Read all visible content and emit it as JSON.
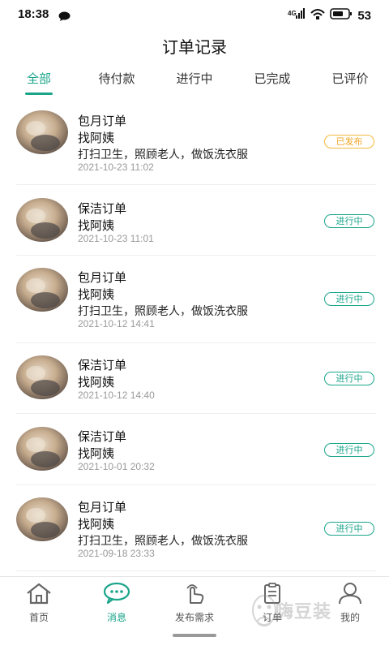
{
  "status_bar": {
    "time": "18:38",
    "battery": "53"
  },
  "page_title": "订单记录",
  "tabs": [
    {
      "label": "全部",
      "active": true
    },
    {
      "label": "待付款",
      "active": false
    },
    {
      "label": "进行中",
      "active": false
    },
    {
      "label": "已完成",
      "active": false
    },
    {
      "label": "已评价",
      "active": false
    }
  ],
  "orders": [
    {
      "title": "包月订单",
      "service": "找阿姨",
      "desc": "打扫卫生，照顾老人，做饭洗衣服",
      "time": "2021-10-23 11:02",
      "status": "已发布"
    },
    {
      "title": "保洁订单",
      "service": "找阿姨",
      "desc": "",
      "time": "2021-10-23 11:01",
      "status": "进行中"
    },
    {
      "title": "包月订单",
      "service": "找阿姨",
      "desc": "打扫卫生，照顾老人，做饭洗衣服",
      "time": "2021-10-12 14:41",
      "status": "进行中"
    },
    {
      "title": "保洁订单",
      "service": "找阿姨",
      "desc": "",
      "time": "2021-10-12 14:40",
      "status": "进行中"
    },
    {
      "title": "保洁订单",
      "service": "找阿姨",
      "desc": "",
      "time": "2021-10-01 20:32",
      "status": "进行中"
    },
    {
      "title": "包月订单",
      "service": "找阿姨",
      "desc": "打扫卫生，照顾老人，做饭洗衣服",
      "time": "2021-09-18 23:33",
      "status": "进行中"
    }
  ],
  "bottom_nav": [
    {
      "label": "首页",
      "icon": "home-icon",
      "active": false
    },
    {
      "label": "消息",
      "icon": "message-icon",
      "active": true
    },
    {
      "label": "发布需求",
      "icon": "publish-icon",
      "active": false
    },
    {
      "label": "订单",
      "icon": "order-icon",
      "active": false
    },
    {
      "label": "我的",
      "icon": "profile-icon",
      "active": false
    }
  ],
  "watermark": "嗨豆装",
  "colors": {
    "accent": "#1aa58a",
    "published": "#f0a622"
  }
}
